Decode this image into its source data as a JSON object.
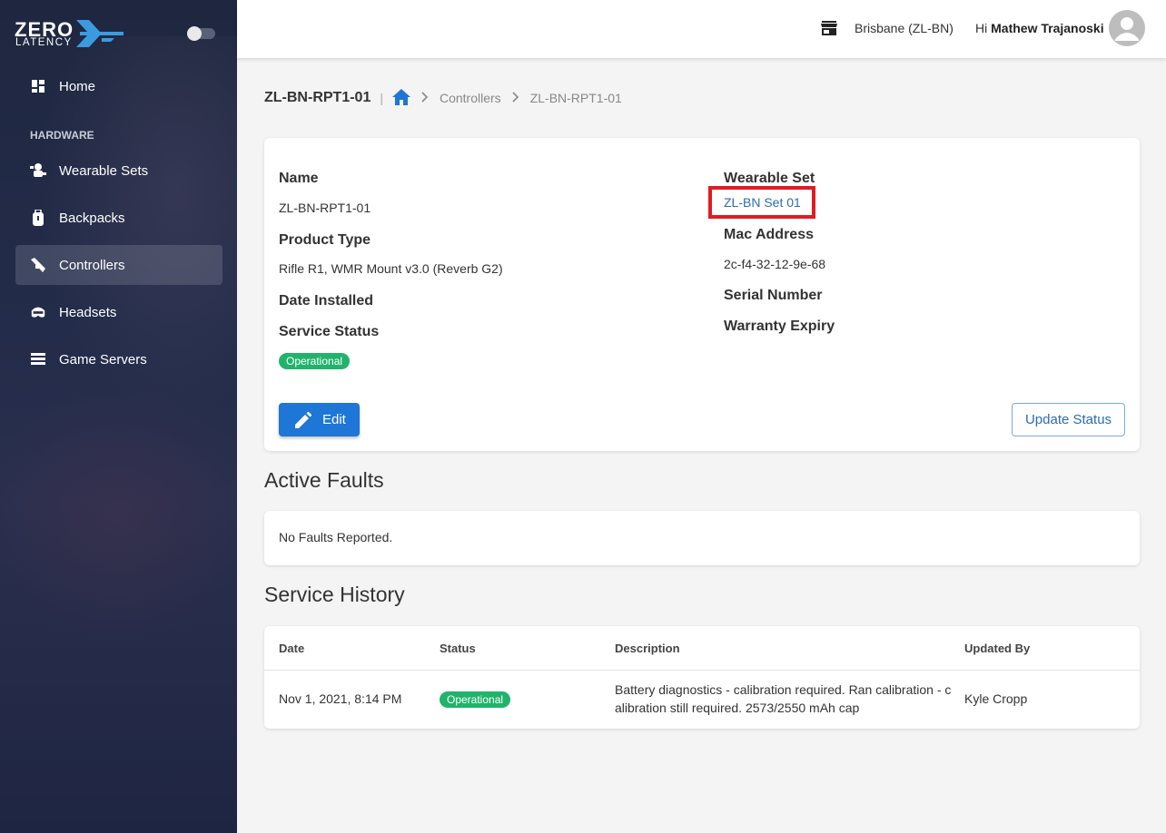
{
  "brand": {
    "line1": "ZERO",
    "line2": "LATENCY"
  },
  "sidebar": {
    "home": "Home",
    "section": "HARDWARE",
    "items": [
      {
        "label": "Wearable Sets",
        "icon": "wearable-sets-icon"
      },
      {
        "label": "Backpacks",
        "icon": "backpack-icon"
      },
      {
        "label": "Controllers",
        "icon": "controller-icon",
        "active": true
      },
      {
        "label": "Headsets",
        "icon": "headset-icon"
      },
      {
        "label": "Game Servers",
        "icon": "server-icon"
      }
    ]
  },
  "topbar": {
    "location": "Brisbane (ZL-BN)",
    "greeting": "Hi",
    "user": "Mathew Trajanoski"
  },
  "breadcrumb": {
    "title": "ZL-BN-RPT1-01",
    "items": [
      "Controllers",
      "ZL-BN-RPT1-01"
    ]
  },
  "details": {
    "name_label": "Name",
    "name_value": "ZL-BN-RPT1-01",
    "product_type_label": "Product Type",
    "product_type_value": "Rifle R1, WMR Mount v3.0 (Reverb G2)",
    "date_installed_label": "Date Installed",
    "service_status_label": "Service Status",
    "service_status_value": "Operational",
    "wearable_set_label": "Wearable Set",
    "wearable_set_value": "ZL-BN Set 01",
    "mac_label": "Mac Address",
    "mac_value": "2c-f4-32-12-9e-68",
    "serial_label": "Serial Number",
    "warranty_label": "Warranty Expiry",
    "edit_button": "Edit",
    "update_button": "Update Status"
  },
  "faults": {
    "title": "Active Faults",
    "message": "No Faults Reported."
  },
  "history": {
    "title": "Service History",
    "columns": [
      "Date",
      "Status",
      "Description",
      "Updated By"
    ],
    "rows": [
      {
        "date": "Nov 1, 2021, 8:14 PM",
        "status": "Operational",
        "description_line1": "Battery diagnostics - calibration required. Ran calibration - c",
        "description_line2": "alibration still required. 2573/2550 mAh cap",
        "updated_by": "Kyle Cropp"
      }
    ]
  },
  "colors": {
    "accent": "#1e76d6",
    "status_ok": "#21b36b",
    "highlight": "#e11b22",
    "sidebar": "#1f2740"
  }
}
